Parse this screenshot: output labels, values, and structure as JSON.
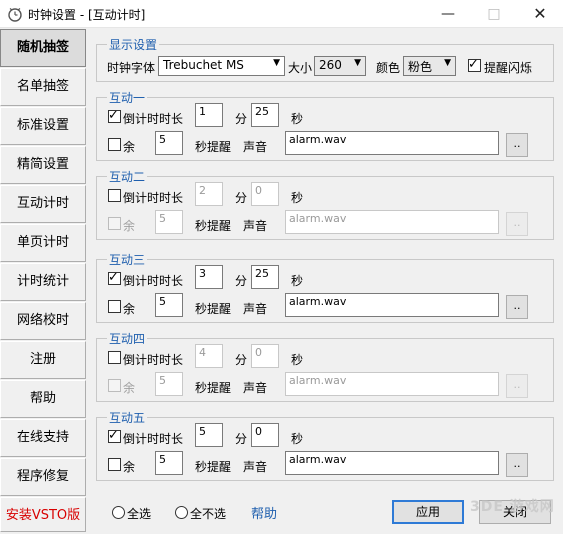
{
  "window": {
    "title": "时钟设置 - [互动计时]",
    "minimize": "—",
    "maximize": "□",
    "close": "✕"
  },
  "sidebar": {
    "items": [
      {
        "label": "随机抽签",
        "active": true
      },
      {
        "label": "名单抽签"
      },
      {
        "label": "标准设置"
      },
      {
        "label": "精简设置"
      },
      {
        "label": "互动计时"
      },
      {
        "label": "单页计时"
      },
      {
        "label": "计时统计"
      },
      {
        "label": "网络校时"
      },
      {
        "label": "注册"
      },
      {
        "label": "帮助"
      },
      {
        "label": "在线支持"
      },
      {
        "label": "程序修复"
      },
      {
        "label": "安装VSTO版",
        "color": "#d80000"
      }
    ]
  },
  "display": {
    "title": "显示设置",
    "font_label": "时钟字体",
    "font_value": "Trebuchet MS",
    "size_label": "大小",
    "size_value": "260",
    "color_label": "颜色",
    "color_value": "粉色",
    "flash_label": "提醒闪烁",
    "flash_checked": true
  },
  "groups": [
    {
      "title": "互动一",
      "countdown_label": "倒计时时长",
      "countdown_checked": true,
      "minutes": "1",
      "min_unit": "分",
      "seconds": "25",
      "sec_unit": "秒",
      "remain_label": "余",
      "remain_value": "5",
      "remind_label": "秒提醒",
      "sound_label": "声音",
      "sound_file": "alarm.wav",
      "browse": "..",
      "enabled": true
    },
    {
      "title": "互动二",
      "countdown_label": "倒计时时长",
      "countdown_checked": false,
      "minutes": "2",
      "min_unit": "分",
      "seconds": "0",
      "sec_unit": "秒",
      "remain_label": "余",
      "remain_value": "5",
      "remind_label": "秒提醒",
      "sound_label": "声音",
      "sound_file": "alarm.wav",
      "browse": "..",
      "enabled": false
    },
    {
      "title": "互动三",
      "countdown_label": "倒计时时长",
      "countdown_checked": true,
      "minutes": "3",
      "min_unit": "分",
      "seconds": "25",
      "sec_unit": "秒",
      "remain_label": "余",
      "remain_value": "5",
      "remind_label": "秒提醒",
      "sound_label": "声音",
      "sound_file": "alarm.wav",
      "browse": "..",
      "enabled": true
    },
    {
      "title": "互动四",
      "countdown_label": "倒计时时长",
      "countdown_checked": false,
      "minutes": "4",
      "min_unit": "分",
      "seconds": "0",
      "sec_unit": "秒",
      "remain_label": "余",
      "remain_value": "5",
      "remind_label": "秒提醒",
      "sound_label": "声音",
      "sound_file": "alarm.wav",
      "browse": "..",
      "enabled": false
    },
    {
      "title": "互动五",
      "countdown_label": "倒计时时长",
      "countdown_checked": true,
      "minutes": "5",
      "min_unit": "分",
      "seconds": "0",
      "sec_unit": "秒",
      "remain_label": "余",
      "remain_value": "5",
      "remind_label": "秒提醒",
      "sound_label": "声音",
      "sound_file": "alarm.wav",
      "browse": "..",
      "enabled": true
    }
  ],
  "bottom": {
    "select_all": "全选",
    "select_none": "全不选",
    "help": "帮助",
    "apply": "应用",
    "close": "关闭"
  },
  "watermark": "3DE 游戏网",
  "colors": {
    "accent": "#1f5fae",
    "vsto_red": "#d80000",
    "default_button_border": "#2e7ad6"
  }
}
